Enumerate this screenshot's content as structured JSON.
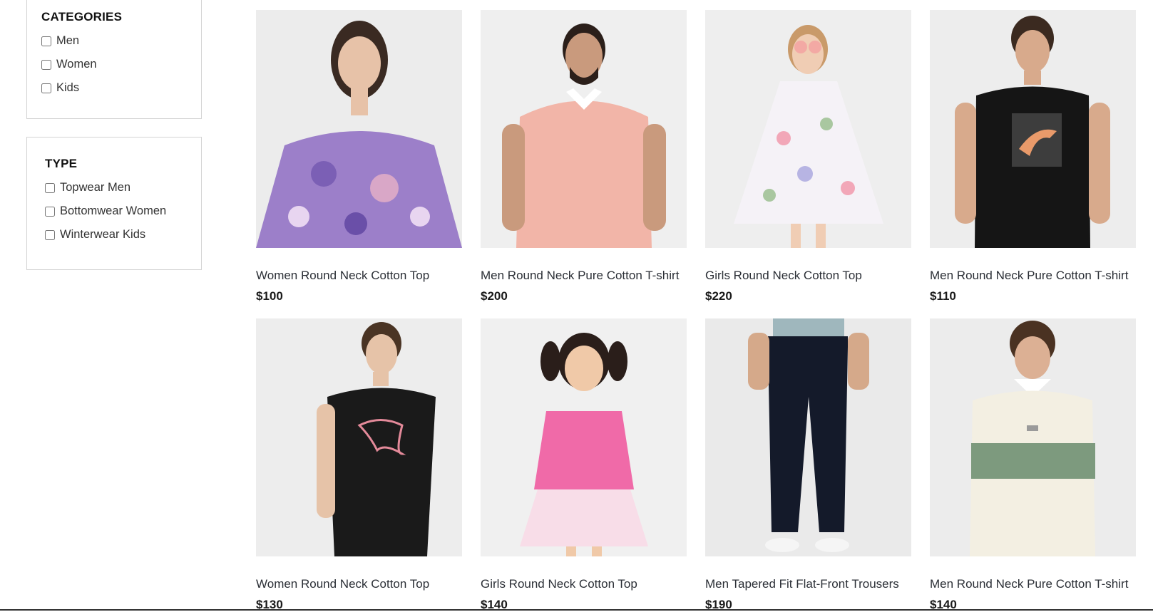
{
  "filters": {
    "categories": {
      "title": "CATEGORIES",
      "options": [
        "Men",
        "Women",
        "Kids"
      ]
    },
    "type": {
      "title": "TYPE",
      "options": [
        "Topwear Men",
        "Bottomwear Women",
        "Winterwear Kids"
      ]
    }
  },
  "products": [
    {
      "name": "Women Round Neck Cotton Top",
      "price": "$100",
      "image": "woman-floral-off-shoulder-top-photo",
      "bg": "#ececec"
    },
    {
      "name": "Men Round Neck Pure Cotton T-shirt",
      "price": "$200",
      "image": "man-pink-polo-photo",
      "bg": "#efefef"
    },
    {
      "name": "Girls Round Neck Cotton Top",
      "price": "$220",
      "image": "girl-floral-dress-photo",
      "bg": "#eeeeee"
    },
    {
      "name": "Men Round Neck Pure Cotton T-shirt",
      "price": "$110",
      "image": "man-black-puma-tshirt-photo",
      "bg": "#ededed"
    },
    {
      "name": "Women Round Neck Cotton Top",
      "price": "$130",
      "image": "woman-black-puma-tshirt-photo",
      "bg": "#ededed"
    },
    {
      "name": "Girls Round Neck Cotton Top",
      "price": "$140",
      "image": "girl-pink-top-photo",
      "bg": "#f0f0f0"
    },
    {
      "name": "Men Tapered Fit Flat-Front Trousers",
      "price": "$190",
      "image": "man-navy-trousers-photo",
      "bg": "#eaeaea"
    },
    {
      "name": "Men Round Neck Pure Cotton T-shirt",
      "price": "$140",
      "image": "man-striped-polo-sweatshirt-photo",
      "bg": "#ececec"
    }
  ]
}
